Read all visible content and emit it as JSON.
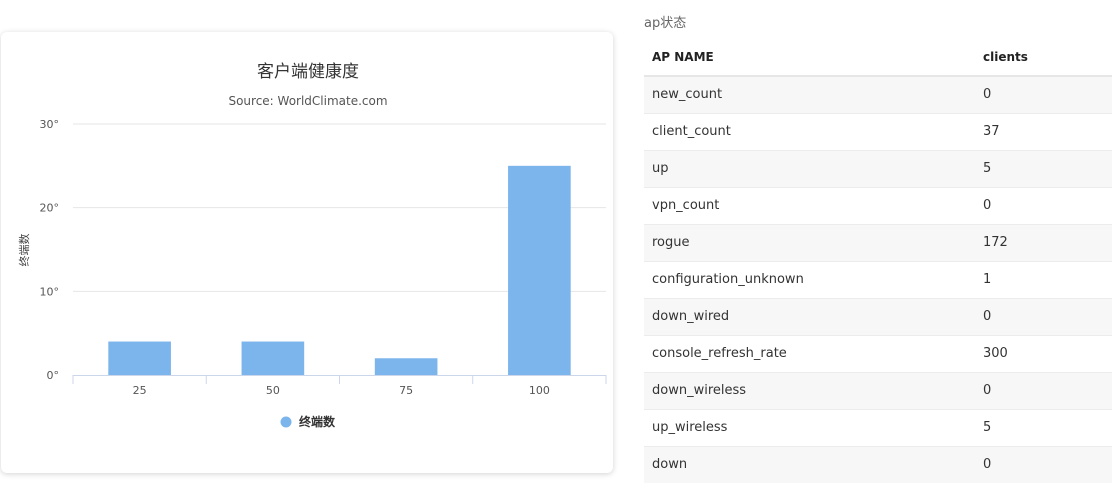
{
  "chart_panel": {
    "title": "客户端健康度",
    "subtitle": "Source: WorldClimate.com",
    "bar_color": "#7cb5ec",
    "chart_data": {
      "type": "bar",
      "title": "客户端健康度",
      "subtitle": "Source: WorldClimate.com",
      "categories": [
        "25",
        "50",
        "75",
        "100"
      ],
      "series": [
        {
          "name": "终端数",
          "values": [
            4,
            4,
            2,
            25
          ]
        }
      ],
      "ylabel": "终端数",
      "xlabel": "",
      "ylim": [
        0,
        30
      ],
      "yticks": [
        {
          "value": 0,
          "label": "0°"
        },
        {
          "value": 10,
          "label": "10°"
        },
        {
          "value": 20,
          "label": "20°"
        },
        {
          "value": 30,
          "label": "30°"
        }
      ],
      "grid": true,
      "legend": "bottom-center"
    }
  },
  "table_panel": {
    "title": "ap状态",
    "columns": [
      "AP NAME",
      "clients"
    ],
    "rows": [
      {
        "name": "new_count",
        "value": "0"
      },
      {
        "name": "client_count",
        "value": "37"
      },
      {
        "name": "up",
        "value": "5"
      },
      {
        "name": "vpn_count",
        "value": "0"
      },
      {
        "name": "rogue",
        "value": "172"
      },
      {
        "name": "configuration_unknown",
        "value": "1"
      },
      {
        "name": "down_wired",
        "value": "0"
      },
      {
        "name": "console_refresh_rate",
        "value": "300"
      },
      {
        "name": "down_wireless",
        "value": "0"
      },
      {
        "name": "up_wireless",
        "value": "5"
      },
      {
        "name": "down",
        "value": "0"
      }
    ]
  }
}
